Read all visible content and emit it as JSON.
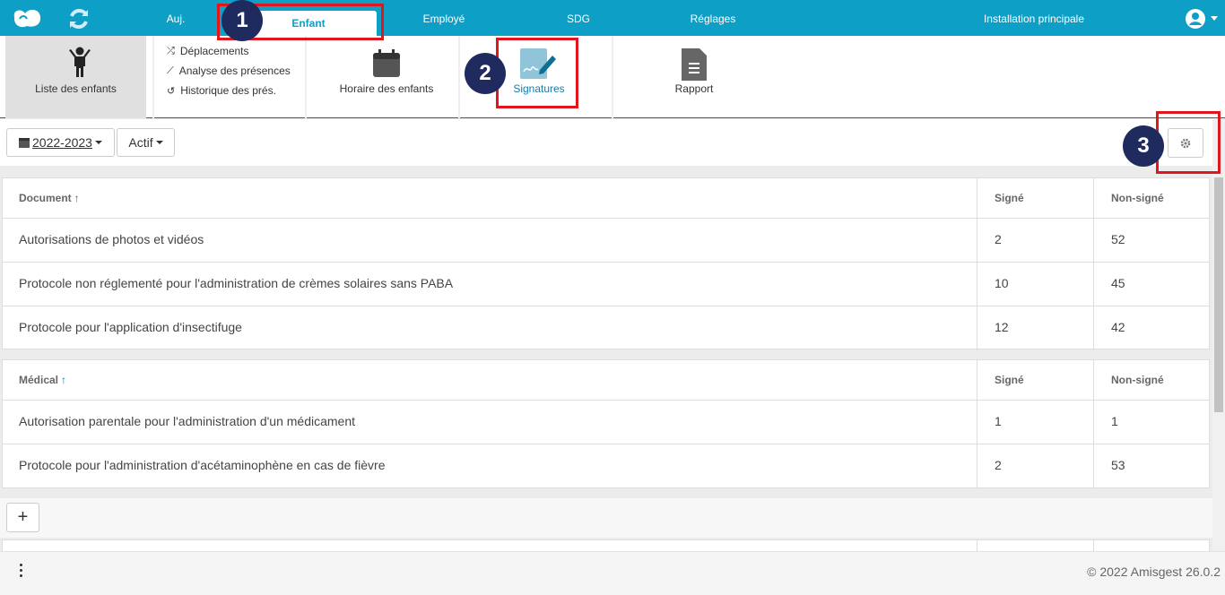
{
  "nav": {
    "tabs": [
      "Auj.",
      "Enfant",
      "Employé",
      "SDG",
      "Réglages",
      "Installation principale"
    ],
    "active_index": 1
  },
  "subnav": {
    "children_list": "Liste des enfants",
    "links": [
      "Déplacements",
      "Analyse des présences",
      "Historique des prés."
    ],
    "schedule": "Horaire des enfants",
    "signatures": "Signatures",
    "report": "Rapport"
  },
  "filters": {
    "year": "2022-2023",
    "status": "Actif"
  },
  "tables": [
    {
      "headers": [
        "Document",
        "Signé",
        "Non-signé"
      ],
      "rows": [
        [
          "Autorisations de photos et vidéos",
          "2",
          "52"
        ],
        [
          "Protocole non réglementé pour l'administration de crèmes solaires sans PABA",
          "10",
          "45"
        ],
        [
          "Protocole pour l'application d'insectifuge",
          "12",
          "42"
        ]
      ]
    },
    {
      "headers": [
        "Médical",
        "Signé",
        "Non-signé"
      ],
      "rows": [
        [
          "Autorisation parentale pour l'administration d'un médicament",
          "1",
          "1"
        ],
        [
          "Protocole pour l'administration d'acétaminophène en cas de fièvre",
          "2",
          "53"
        ]
      ]
    }
  ],
  "add_button": "+",
  "footer": {
    "copyright": "© 2022 Amisgest 26.0.2"
  },
  "badges": [
    "1",
    "2",
    "3"
  ],
  "colors": {
    "brand": "#0e9fc6",
    "highlight": "#e0161e",
    "badge": "#1f2a5e"
  }
}
